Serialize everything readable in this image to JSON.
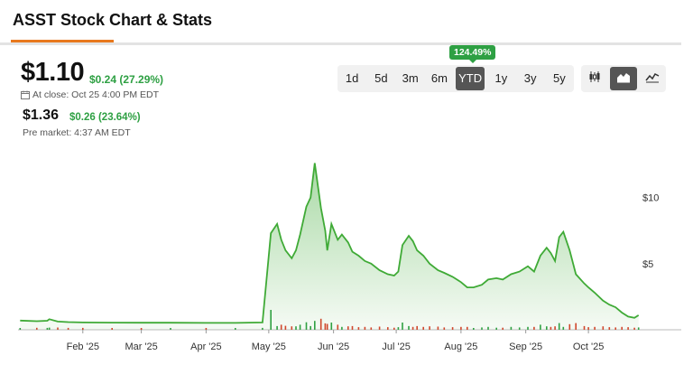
{
  "header": {
    "title": "ASST Stock Chart & Stats"
  },
  "quote": {
    "price": "$1.10",
    "change": "$0.24 (27.29%)",
    "close_label": "At close: Oct 25 4:00 PM EDT",
    "premarket_price": "$1.36",
    "premarket_change": "$0.26 (23.64%)",
    "premarket_label": "Pre market: 4:37 AM EDT"
  },
  "range_selector": {
    "options": [
      "1d",
      "5d",
      "3m",
      "6m",
      "YTD",
      "1y",
      "3y",
      "5y"
    ],
    "selected": "YTD",
    "badge": "124.49%"
  },
  "chart_types": [
    {
      "name": "candlestick-icon",
      "active": false
    },
    {
      "name": "area-chart-icon",
      "active": true
    },
    {
      "name": "line-chart-icon",
      "active": false
    }
  ],
  "colors": {
    "accent": "#e8791e",
    "positive": "#2ea043",
    "negative": "#d9412b",
    "line": "#3faa36"
  },
  "chart_data": {
    "type": "area",
    "title": "",
    "xlabel": "",
    "ylabel": "",
    "x_ticks": [
      "Feb '25",
      "Mar '25",
      "Apr '25",
      "May '25",
      "Jun '25",
      "Jul '25",
      "Aug '25",
      "Sep '25",
      "Oct '25"
    ],
    "y_ticks": [
      "$10",
      "$5"
    ],
    "ylim": [
      0,
      14
    ],
    "series": [
      {
        "x": [
          "2025-01-02",
          "2025-01-10",
          "2025-01-15",
          "2025-01-16",
          "2025-01-20",
          "2025-01-25",
          "2025-02-01",
          "2025-02-15",
          "2025-03-01",
          "2025-03-15",
          "2025-04-01",
          "2025-04-15",
          "2025-04-28",
          "2025-05-02",
          "2025-05-05",
          "2025-05-07",
          "2025-05-09",
          "2025-05-12",
          "2025-05-14",
          "2025-05-16",
          "2025-05-19",
          "2025-05-21",
          "2025-05-23",
          "2025-05-26",
          "2025-05-28",
          "2025-05-29",
          "2025-05-31",
          "2025-06-03",
          "2025-06-05",
          "2025-06-08",
          "2025-06-10",
          "2025-06-13",
          "2025-06-16",
          "2025-06-19",
          "2025-06-23",
          "2025-06-27",
          "2025-06-30",
          "2025-07-02",
          "2025-07-04",
          "2025-07-07",
          "2025-07-09",
          "2025-07-11",
          "2025-07-14",
          "2025-07-17",
          "2025-07-21",
          "2025-07-24",
          "2025-07-28",
          "2025-08-01",
          "2025-08-04",
          "2025-08-07",
          "2025-08-11",
          "2025-08-14",
          "2025-08-18",
          "2025-08-21",
          "2025-08-25",
          "2025-08-29",
          "2025-09-02",
          "2025-09-05",
          "2025-09-08",
          "2025-09-11",
          "2025-09-13",
          "2025-09-15",
          "2025-09-17",
          "2025-09-19",
          "2025-09-22",
          "2025-09-25",
          "2025-09-29",
          "2025-10-01",
          "2025-10-04",
          "2025-10-08",
          "2025-10-11",
          "2025-10-14",
          "2025-10-17",
          "2025-10-20",
          "2025-10-23",
          "2025-10-25"
        ],
        "y": [
          0.7,
          0.65,
          0.68,
          0.8,
          0.62,
          0.58,
          0.55,
          0.54,
          0.53,
          0.53,
          0.52,
          0.52,
          0.55,
          7.3,
          8.0,
          6.8,
          6.0,
          5.4,
          6.0,
          7.2,
          9.3,
          10.0,
          12.6,
          9.2,
          7.5,
          6.0,
          8.0,
          6.8,
          7.2,
          6.6,
          5.9,
          5.6,
          5.2,
          5.0,
          4.5,
          4.2,
          4.1,
          4.4,
          6.4,
          7.1,
          6.7,
          6.0,
          5.6,
          5.0,
          4.5,
          4.3,
          4.0,
          3.6,
          3.2,
          3.2,
          3.4,
          3.8,
          3.9,
          3.8,
          4.2,
          4.4,
          4.8,
          4.4,
          5.6,
          6.2,
          5.8,
          5.2,
          7.0,
          7.4,
          6.0,
          4.2,
          3.5,
          3.2,
          2.8,
          2.2,
          1.9,
          1.7,
          1.3,
          1.0,
          0.9,
          1.1
        ]
      }
    ],
    "grid": false,
    "legend": "none"
  }
}
